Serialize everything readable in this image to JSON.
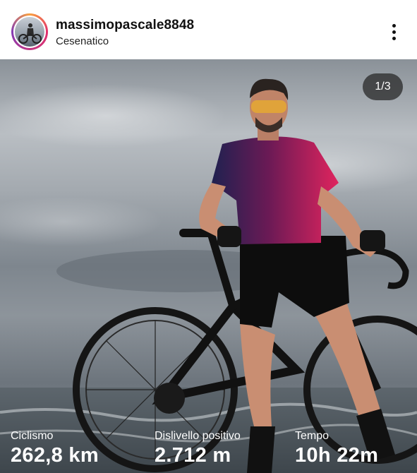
{
  "post": {
    "username": "massimopascale8848",
    "location": "Cesenatico",
    "counter": "1/3"
  },
  "icons": {
    "more": "more-vertical-icon",
    "avatar": "avatar-image"
  },
  "stats": [
    {
      "label": "Ciclismo",
      "value": "262,8 km"
    },
    {
      "label": "Dislivello positivo",
      "value": "2.712 m"
    },
    {
      "label": "Tempo",
      "value": "10h 22m"
    }
  ]
}
